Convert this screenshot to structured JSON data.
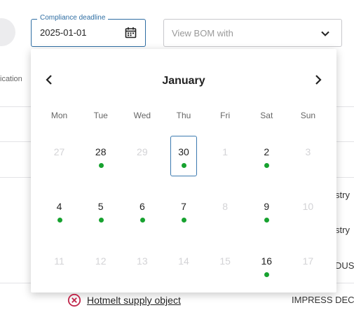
{
  "table": {
    "column_label": "ication",
    "right_cells": [
      "stry",
      "stry",
      "DUS"
    ]
  },
  "filters": {
    "date_label": "Compliance deadline",
    "date_value": "2025-01-01",
    "bom_placeholder": "View BOM with"
  },
  "calendar": {
    "month": "January",
    "weekdays": [
      "Mon",
      "Tue",
      "Wed",
      "Thu",
      "Fri",
      "Sat",
      "Sun"
    ],
    "weeks": [
      [
        {
          "day": "27",
          "muted": true
        },
        {
          "day": "28",
          "marked": true
        },
        {
          "day": "29",
          "muted": true
        },
        {
          "day": "30",
          "marked": true,
          "current": true
        },
        {
          "day": "1",
          "muted": true
        },
        {
          "day": "2",
          "marked": true
        },
        {
          "day": "3",
          "muted": true
        }
      ],
      [
        {
          "day": "4",
          "marked": true
        },
        {
          "day": "5",
          "marked": true
        },
        {
          "day": "6",
          "marked": true
        },
        {
          "day": "7",
          "marked": true
        },
        {
          "day": "8",
          "muted": true
        },
        {
          "day": "9",
          "marked": true
        },
        {
          "day": "10",
          "muted": true
        }
      ],
      [
        {
          "day": "11",
          "muted": true
        },
        {
          "day": "12",
          "muted": true
        },
        {
          "day": "13",
          "muted": true
        },
        {
          "day": "14",
          "muted": true
        },
        {
          "day": "15",
          "muted": true
        },
        {
          "day": "16",
          "marked": true
        },
        {
          "day": "17",
          "muted": true
        }
      ]
    ]
  },
  "row": {
    "link_text": "Hotmelt supply object",
    "right_text": "IMPRESS DEC"
  },
  "colors": {
    "accent": "#2f6ea3",
    "marker": "#17a22f",
    "error": "#c0254a"
  }
}
